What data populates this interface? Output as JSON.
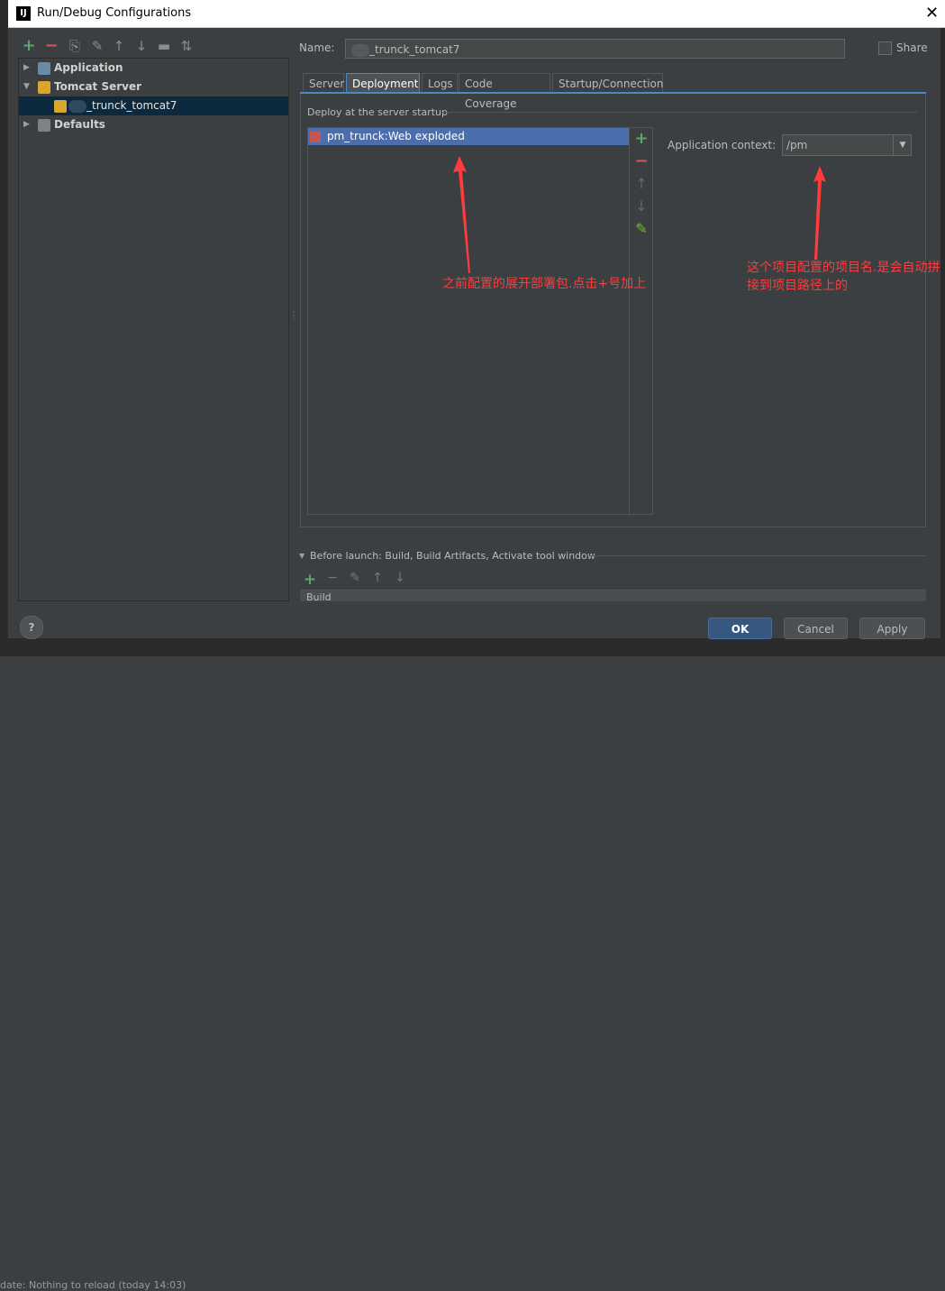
{
  "window": {
    "title": "Run/Debug Configurations",
    "app_icon": "IJ"
  },
  "toolbar": {
    "icons": [
      "add-icon",
      "remove-icon",
      "copy-icon",
      "wrench-icon",
      "arrow-up-icon",
      "arrow-down-icon",
      "folder-icon",
      "sort-icon"
    ]
  },
  "tree": {
    "items": [
      {
        "label": "Application"
      },
      {
        "label": "Tomcat Server"
      },
      {
        "label": "_trunck_tomcat7"
      },
      {
        "label": "Defaults"
      }
    ]
  },
  "form": {
    "name_label": "Name:",
    "name_value": "_trunck_tomcat7",
    "share_label": "Share"
  },
  "tabs": [
    {
      "label": "Server"
    },
    {
      "label": "Deployment"
    },
    {
      "label": "Logs"
    },
    {
      "label": "Code Coverage"
    },
    {
      "label": "Startup/Connection"
    }
  ],
  "deployment": {
    "header": "Deploy at the server startup",
    "items": [
      "pm_trunck:Web exploded"
    ],
    "context_label": "Application context:",
    "context_value": "/pm"
  },
  "annotations": {
    "left": "之前配置的展开部署包.点击+号加上",
    "right": "这个项目配置的项目名.是会自动拼接到项目路径上的"
  },
  "before_launch": {
    "label": "Before launch: Build, Build Artifacts, Activate tool window",
    "item": "Build"
  },
  "buttons": {
    "ok": "OK",
    "cancel": "Cancel",
    "apply": "Apply",
    "help": "?"
  },
  "background": {
    "status_text": "date: Nothing to reload (today 14:03)"
  },
  "colors": {
    "accent": "#4a88c7",
    "selection": "#4b6eaf",
    "annotation": "#ff3b3b"
  }
}
